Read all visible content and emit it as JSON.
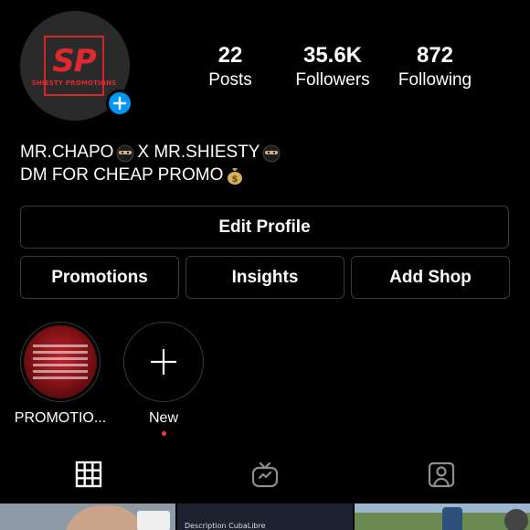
{
  "profile": {
    "avatar_logo_text": "SP",
    "avatar_logo_subtext": "SHIESTY PROMOTIONS",
    "accent_red": "#e0282f",
    "badge_color": "#0095f6"
  },
  "stats": {
    "posts": {
      "value": "22",
      "label": "Posts"
    },
    "followers": {
      "value": "35.6K",
      "label": "Followers"
    },
    "following": {
      "value": "872",
      "label": "Following"
    }
  },
  "bio": {
    "line1_part1": "MR.CHAPO",
    "line1_part2": " X MR.SHIESTY",
    "line2": "DM FOR CHEAP PROMO",
    "line1_emoji": "ninja-emoji",
    "line2_emoji": "money-bag-emoji"
  },
  "buttons": {
    "edit_profile": "Edit Profile",
    "promotions": "Promotions",
    "insights": "Insights",
    "add_shop": "Add Shop"
  },
  "highlights": [
    {
      "label": "PROMOTIO..."
    },
    {
      "label": "New"
    }
  ],
  "tabs": [
    "grid-icon",
    "igtv-icon",
    "tagged-icon"
  ],
  "thumbnails": {
    "thumb2_text": "Description   CubaLibre"
  }
}
